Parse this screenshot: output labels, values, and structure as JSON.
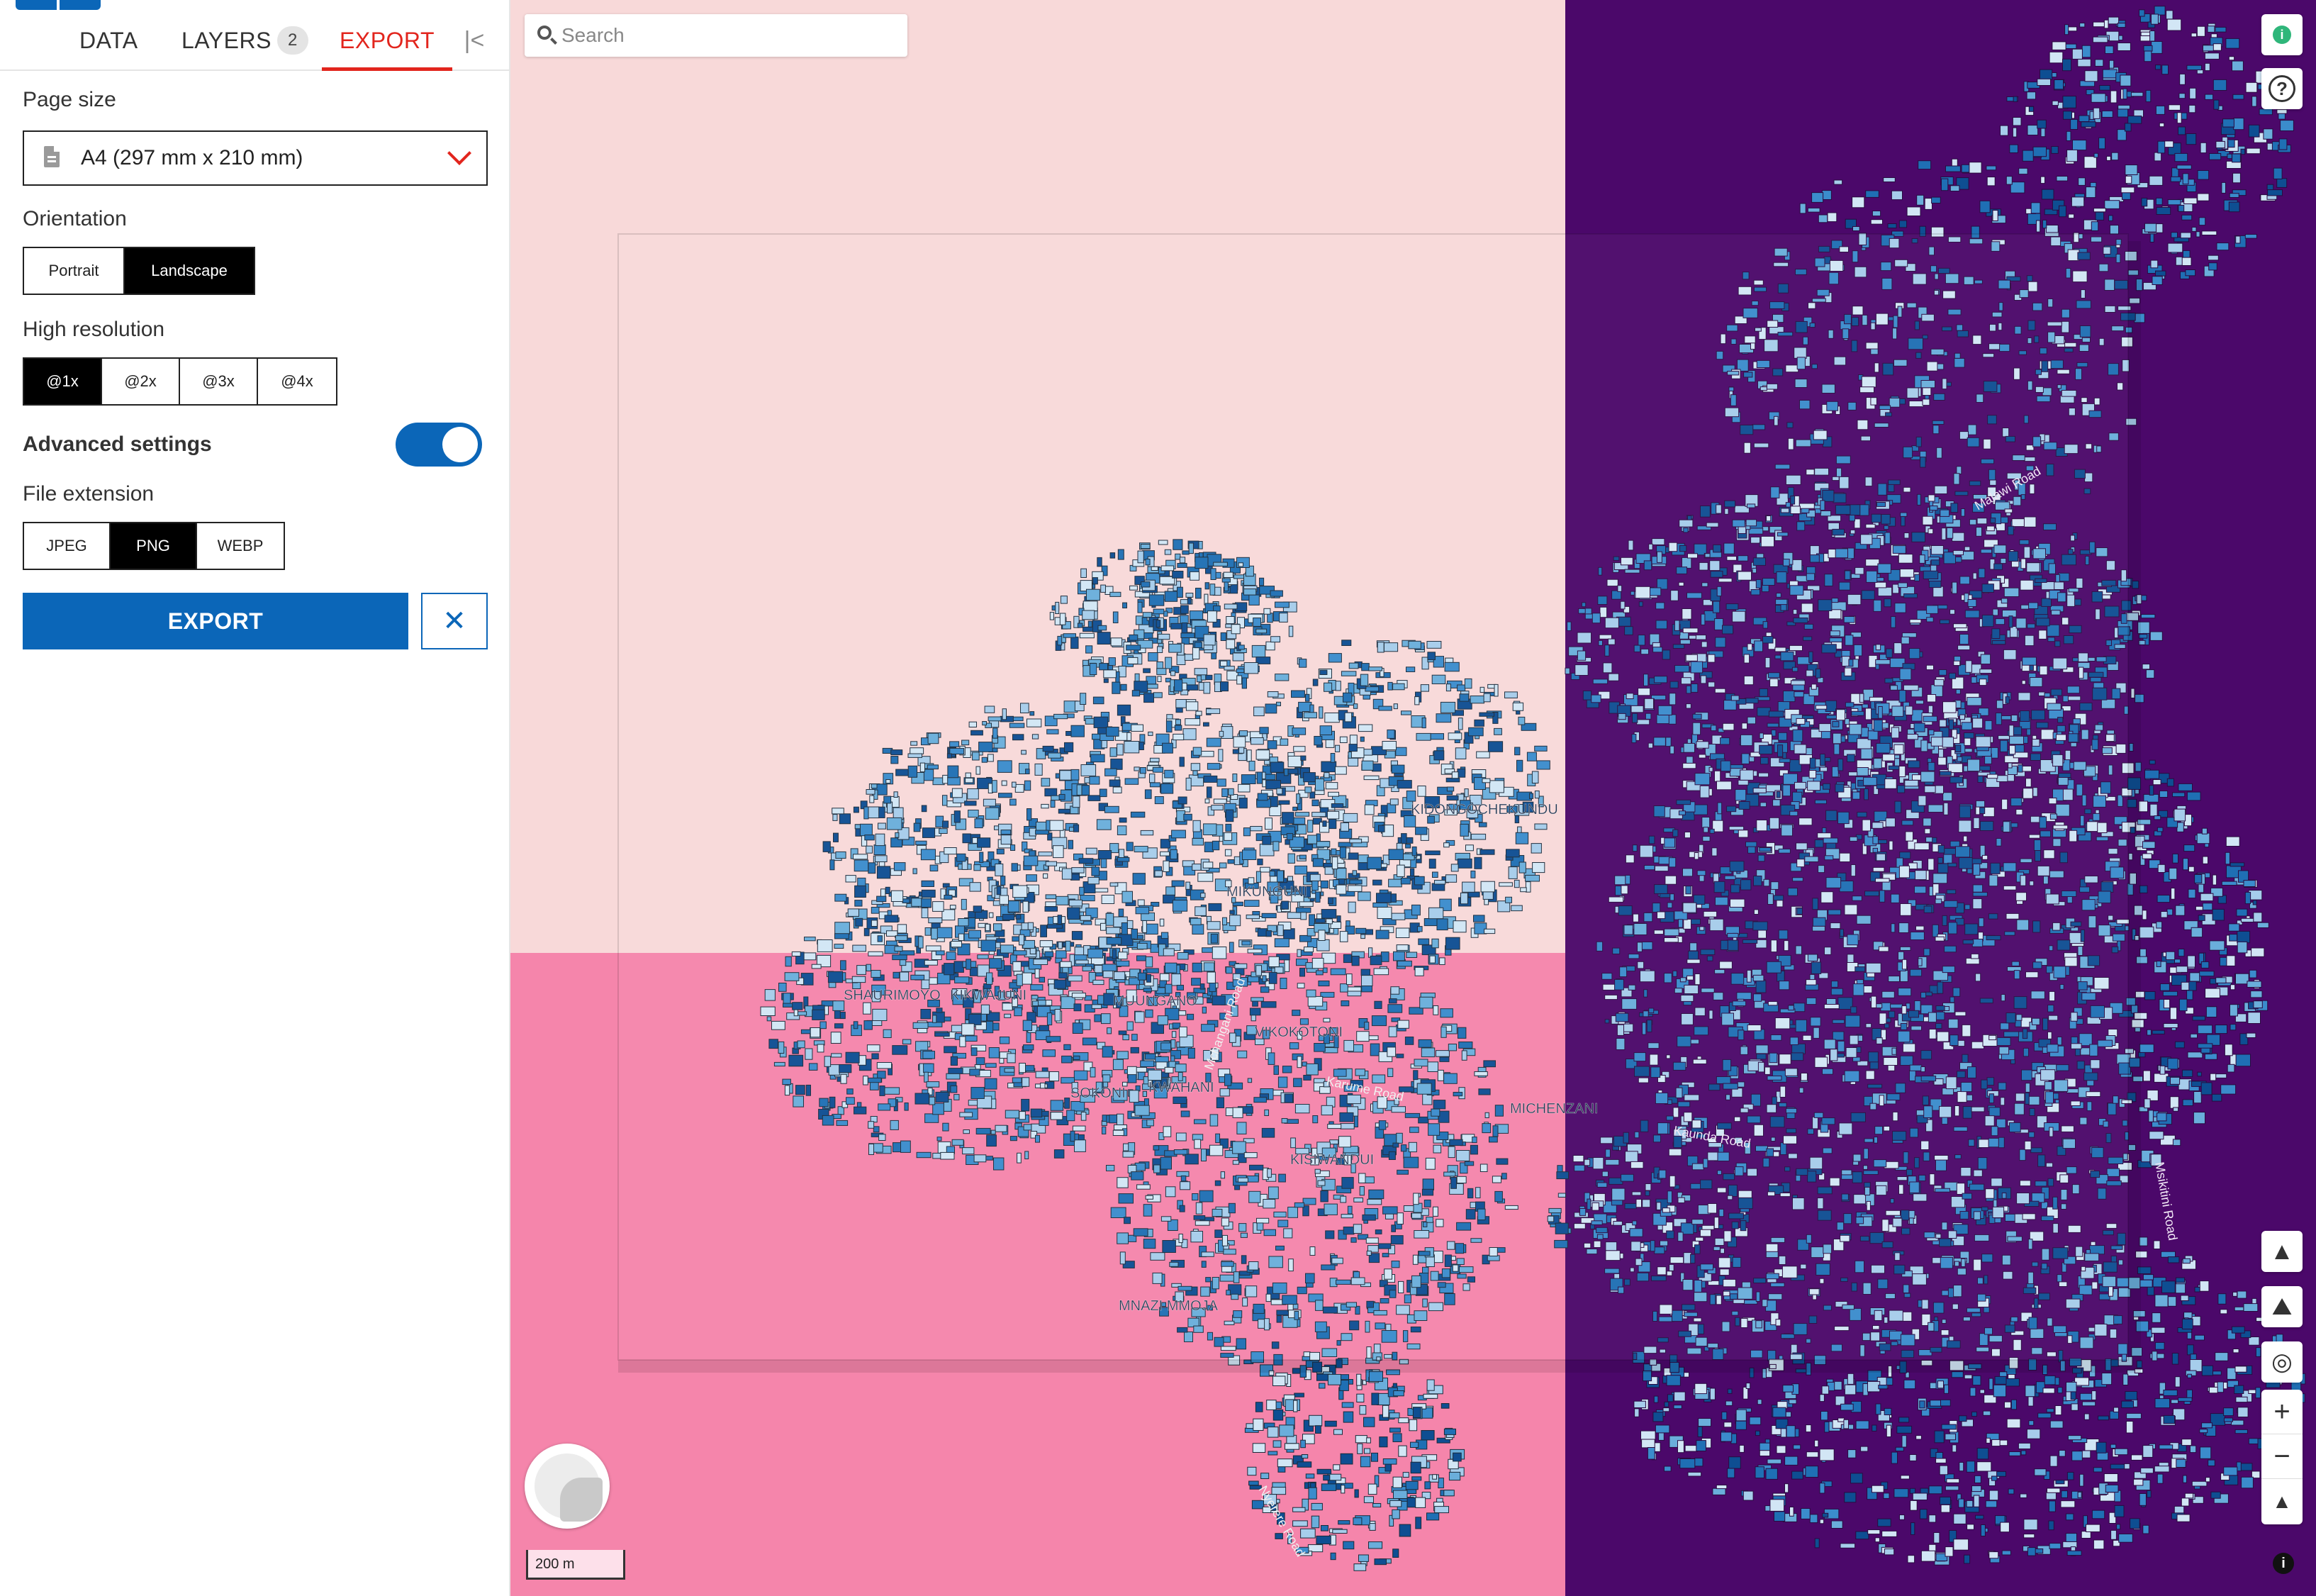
{
  "tabs": {
    "data": "DATA",
    "layers": "LAYERS",
    "layers_count": "2",
    "export": "EXPORT"
  },
  "export_panel": {
    "page_size_label": "Page size",
    "page_size_value": "A4 (297 mm x 210 mm)",
    "orientation_label": "Orientation",
    "orientation_options": [
      "Portrait",
      "Landscape"
    ],
    "orientation_selected": "Landscape",
    "resolution_label": "High resolution",
    "resolution_options": [
      "@1x",
      "@2x",
      "@3x",
      "@4x"
    ],
    "resolution_selected": "@1x",
    "advanced_label": "Advanced settings",
    "advanced_enabled": true,
    "extension_label": "File extension",
    "extension_options": [
      "JPEG",
      "PNG",
      "WEBP"
    ],
    "extension_selected": "PNG",
    "export_button": "EXPORT",
    "cancel_icon": "close-icon"
  },
  "map": {
    "search_placeholder": "Search",
    "scale_label": "200 m",
    "info_badge": "i",
    "help_icon": "?",
    "attribution_icon": "i",
    "controls": [
      "terrain-icon",
      "hillshade-icon",
      "locate-icon",
      "zoom-in-icon",
      "zoom-out-icon",
      "compass-icon"
    ],
    "place_labels": [
      "SHAURIMOYO",
      "KIKWAJUNI",
      "MUUNGANO",
      "VIKOKOTONI",
      "MICHENZANI",
      "MNAZI MMOJA",
      "KISIWANDUI",
      "KWAHANI",
      "MIKUNGUNI",
      "SOKONI",
      "KIDONGOCHEKUNDU"
    ],
    "road_labels": [
      "Karume Road",
      "Mchangani Road",
      "Nyerere Road",
      "Malawi Road",
      "Msikitini Road",
      "Kaunda Road"
    ],
    "colors": {
      "base_light": "#f8d9d9",
      "base_pink": "#f585ab",
      "base_purple": "#4b086a",
      "buildings": "#2c84c6",
      "accent": "#0b66b8",
      "active_tab": "#e2251d"
    }
  }
}
